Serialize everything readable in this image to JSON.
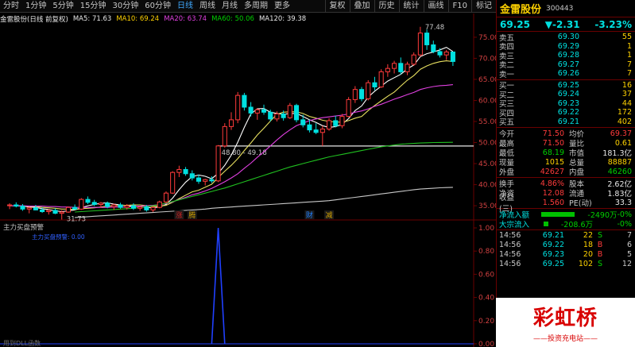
{
  "toolbar": {
    "periods": [
      "分时",
      "1分钟",
      "5分钟",
      "15分钟",
      "30分钟",
      "60分钟",
      "日线",
      "周线",
      "月线",
      "多周期",
      "更多"
    ],
    "active": "日线",
    "actions": [
      "复权",
      "叠加",
      "历史",
      "统计",
      "画线",
      "F10",
      "标记"
    ]
  },
  "infoline": {
    "name": "金雷股份(日线 前复权)",
    "ma5": "MA5: 71.63",
    "ma10": "MA10: 69.24",
    "ma20": "MA20: 63.74",
    "ma60": "MA60: 50.06",
    "ma120": "MA120: 39.38"
  },
  "annotations": {
    "high_label": "77.48",
    "low_label": "31.73",
    "box_label": "48.80 - 49.18",
    "marker1": "涨",
    "marker2": "腾",
    "marker3": "财",
    "marker4": "减",
    "lower_title": "主力买盘预警",
    "lower_sub": "主力买盘预警: 0.00",
    "bottom_label": "用到DLL函数"
  },
  "axis": {
    "ticks": [
      "75.00",
      "70.00",
      "65.00",
      "60.00",
      "55.00",
      "50.00",
      "45.00",
      "40.00",
      "35.00"
    ],
    "lower_ticks": [
      "1.00",
      "0.80",
      "0.60",
      "0.40",
      "0.20",
      "0.00"
    ]
  },
  "quote": {
    "name": "金雷股份",
    "code": "300443",
    "price": "69.25",
    "change": "▼-2.31",
    "pct": "-3.23%"
  },
  "sells": [
    {
      "label": "卖五",
      "price": "69.30",
      "vol": "55"
    },
    {
      "label": "卖四",
      "price": "69.29",
      "vol": "1"
    },
    {
      "label": "卖三",
      "price": "69.28",
      "vol": "1"
    },
    {
      "label": "卖二",
      "price": "69.27",
      "vol": "7"
    },
    {
      "label": "卖一",
      "price": "69.26",
      "vol": "7"
    }
  ],
  "buys": [
    {
      "label": "买一",
      "price": "69.25",
      "vol": "16"
    },
    {
      "label": "买二",
      "price": "69.24",
      "vol": "37"
    },
    {
      "label": "买三",
      "price": "69.23",
      "vol": "44"
    },
    {
      "label": "买四",
      "price": "69.22",
      "vol": "172"
    },
    {
      "label": "买五",
      "price": "69.21",
      "vol": "402"
    }
  ],
  "stats": [
    {
      "l1": "今开",
      "v1": "71.50",
      "c1": "red",
      "l2": "均价",
      "v2": "69.37",
      "c2": "red"
    },
    {
      "l1": "最高",
      "v1": "71.50",
      "c1": "red",
      "l2": "量比",
      "v2": "0.61",
      "c2": "yel"
    },
    {
      "l1": "最低",
      "v1": "68.19",
      "c1": "grn",
      "l2": "市值",
      "v2": "181.3亿",
      "c2": "wht"
    },
    {
      "l1": "现量",
      "v1": "1015",
      "c1": "yel",
      "l2": "总量",
      "v2": "88887",
      "c2": "yel"
    },
    {
      "l1": "外盘",
      "v1": "42627",
      "c1": "red",
      "l2": "内盘",
      "v2": "46260",
      "c2": "grn"
    }
  ],
  "stats2": [
    {
      "l1": "换手",
      "v1": "4.86%",
      "l2": "股本",
      "v2": "2.62亿"
    },
    {
      "l1": "净资",
      "v1": "12.08",
      "l2": "流通",
      "v2": "1.83亿"
    },
    {
      "l1": "收益(三)",
      "v1": "1.560",
      "l2": "PE(动)",
      "v2": "33.3"
    }
  ],
  "flows": [
    {
      "label": "净流入额",
      "value": "-2490万",
      "pct": "-0%"
    },
    {
      "label": "大宗流入",
      "value": "-208.6万",
      "pct": "-0%"
    }
  ],
  "ticks": [
    {
      "time": "14:56",
      "price": "69.21",
      "vol": "22",
      "side": "S",
      "n": "7"
    },
    {
      "time": "14:56",
      "price": "69.22",
      "vol": "18",
      "side": "B",
      "n": "6"
    },
    {
      "time": "14:56",
      "price": "69.23",
      "vol": "20",
      "side": "B",
      "n": "5"
    },
    {
      "time": "14:56",
      "price": "69.25",
      "vol": "102",
      "side": "S",
      "n": "12"
    }
  ],
  "logo": {
    "title": "彩虹桥",
    "sub": "——投资充电站——"
  },
  "colors": {
    "up": "#ff3b3b",
    "down": "#00e0e0",
    "ma5": "#ffffff",
    "ma10": "#e8e060",
    "ma20": "#e040e0",
    "ma60": "#20c020",
    "ma120": "#c8c8c8",
    "border": "#6a0000"
  },
  "chart_data": {
    "type": "candlestick",
    "ylim": [
      32,
      78
    ],
    "candles": [
      [
        35,
        35.6,
        34.2,
        35.2
      ],
      [
        35.2,
        35.8,
        34.6,
        34.9
      ],
      [
        34.9,
        35.4,
        33.8,
        34.2
      ],
      [
        34.2,
        34.8,
        33.2,
        34.5
      ],
      [
        34.5,
        35.2,
        33.9,
        34.0
      ],
      [
        34.0,
        34.6,
        33.3,
        33.6
      ],
      [
        33.6,
        34.2,
        32.9,
        33.9
      ],
      [
        33.9,
        34.4,
        33.0,
        33.2
      ],
      [
        33.2,
        33.9,
        31.73,
        33.5
      ],
      [
        33.5,
        34.8,
        33.3,
        34.6
      ],
      [
        34.6,
        35.3,
        34.0,
        34.2
      ],
      [
        34.2,
        36.8,
        34.0,
        36.5
      ],
      [
        36.5,
        37.2,
        35.4,
        35.8
      ],
      [
        35.8,
        36.4,
        34.9,
        35.3
      ],
      [
        35.3,
        35.9,
        34.5,
        35.6
      ],
      [
        35.6,
        36.0,
        34.4,
        34.8
      ],
      [
        34.8,
        35.5,
        34.0,
        35.2
      ],
      [
        35.2,
        35.7,
        34.3,
        34.6
      ],
      [
        34.6,
        35.4,
        34.1,
        35.0
      ],
      [
        35.0,
        35.6,
        34.0,
        34.4
      ],
      [
        34.4,
        35.0,
        33.8,
        34.7
      ],
      [
        34.7,
        35.2,
        33.6,
        34.0
      ],
      [
        34.0,
        34.9,
        33.5,
        34.6
      ],
      [
        34.6,
        36.2,
        34.4,
        35.9
      ],
      [
        35.9,
        38.4,
        35.6,
        38.0
      ],
      [
        38.0,
        43.2,
        37.8,
        42.9
      ],
      [
        42.9,
        44.5,
        41.8,
        43.6
      ],
      [
        43.6,
        44.2,
        42.1,
        42.6
      ],
      [
        42.6,
        43.4,
        41.0,
        41.6
      ],
      [
        41.6,
        42.4,
        40.2,
        40.8
      ],
      [
        40.8,
        41.4,
        39.8,
        41.2
      ],
      [
        41.2,
        42.0,
        40.4,
        40.9
      ],
      [
        40.9,
        49.4,
        40.6,
        49.2
      ],
      [
        49.2,
        54.6,
        48.8,
        53.8
      ],
      [
        53.8,
        57.2,
        53.0,
        55.4
      ],
      [
        55.4,
        62.0,
        54.6,
        61.2
      ],
      [
        61.2,
        61.8,
        57.6,
        58.4
      ],
      [
        58.4,
        59.6,
        56.2,
        57.0
      ],
      [
        57.0,
        58.2,
        55.4,
        57.8
      ],
      [
        57.8,
        59.0,
        56.6,
        57.2
      ],
      [
        57.2,
        57.8,
        55.0,
        55.6
      ],
      [
        55.6,
        57.4,
        55.0,
        56.8
      ],
      [
        56.8,
        57.6,
        55.2,
        55.9
      ],
      [
        55.9,
        59.4,
        55.6,
        58.8
      ],
      [
        58.8,
        59.2,
        54.8,
        55.4
      ],
      [
        55.4,
        56.6,
        53.6,
        54.2
      ],
      [
        54.2,
        55.4,
        52.4,
        53.0
      ],
      [
        53.0,
        54.6,
        52.0,
        52.4
      ],
      [
        52.4,
        54.0,
        49.18,
        53.2
      ],
      [
        53.2,
        55.8,
        52.8,
        55.2
      ],
      [
        55.2,
        56.4,
        53.6,
        54.0
      ],
      [
        54.0,
        56.8,
        53.4,
        56.2
      ],
      [
        56.2,
        60.8,
        56.0,
        60.2
      ],
      [
        60.2,
        63.4,
        59.4,
        62.6
      ],
      [
        62.6,
        63.2,
        59.8,
        60.4
      ],
      [
        60.4,
        64.8,
        60.0,
        64.2
      ],
      [
        64.2,
        65.6,
        62.4,
        63.2
      ],
      [
        63.2,
        67.4,
        63.0,
        66.8
      ],
      [
        66.8,
        68.6,
        65.6,
        67.6
      ],
      [
        67.6,
        69.4,
        66.4,
        68.8
      ],
      [
        68.8,
        70.2,
        66.2,
        66.8
      ],
      [
        66.8,
        69.2,
        66.0,
        68.6
      ],
      [
        68.6,
        71.4,
        68.2,
        70.8
      ],
      [
        70.8,
        77.48,
        70.4,
        76.0
      ],
      [
        76.0,
        76.8,
        72.0,
        73.2
      ],
      [
        73.2,
        74.2,
        71.2,
        71.6
      ],
      [
        71.6,
        72.4,
        70.2,
        70.8
      ],
      [
        70.8,
        72.0,
        69.6,
        71.5
      ],
      [
        71.5,
        71.5,
        68.19,
        69.25
      ]
    ],
    "ma_series": [
      {
        "name": "MA5",
        "values": [
          35.0,
          35.0,
          34.9,
          34.7,
          34.6,
          34.3,
          34.1,
          33.8,
          33.6,
          33.8,
          34.0,
          34.5,
          35.0,
          35.3,
          35.6,
          35.7,
          35.4,
          35.2,
          35.0,
          34.9,
          34.8,
          34.6,
          34.5,
          34.7,
          35.3,
          36.8,
          38.8,
          40.6,
          41.9,
          42.3,
          42.0,
          41.4,
          42.7,
          44.6,
          47.0,
          50.1,
          53.6,
          56.8,
          58.0,
          58.1,
          57.2,
          56.9,
          56.7,
          56.9,
          56.9,
          56.2,
          55.4,
          54.8,
          54.0,
          53.6,
          53.8,
          54.3,
          55.7,
          57.6,
          58.7,
          60.8,
          62.2,
          63.4,
          64.6,
          65.4,
          66.2,
          67.5,
          68.4,
          70.4,
          71.1,
          71.5,
          72.0,
          72.6,
          71.6
        ]
      },
      {
        "name": "MA10",
        "values": [
          35.0,
          35.0,
          34.9,
          34.8,
          34.8,
          34.6,
          34.5,
          34.4,
          34.2,
          34.2,
          34.1,
          34.3,
          34.4,
          34.5,
          34.7,
          34.9,
          35.0,
          35.1,
          35.1,
          35.2,
          35.2,
          35.0,
          34.8,
          34.9,
          35.1,
          35.8,
          36.7,
          37.5,
          38.3,
          38.7,
          39.4,
          40.1,
          41.7,
          43.2,
          44.6,
          46.2,
          48.1,
          49.9,
          51.8,
          53.4,
          55.1,
          56.7,
          57.2,
          57.3,
          57.3,
          56.9,
          56.2,
          55.8,
          55.3,
          55.0,
          54.9,
          54.8,
          55.2,
          55.8,
          56.2,
          57.6,
          58.8,
          59.9,
          61.0,
          62.0,
          63.4,
          64.8,
          65.9,
          67.4,
          68.2,
          68.8,
          69.2,
          69.4,
          69.24
        ]
      },
      {
        "name": "MA20",
        "values": [
          35.0,
          35.0,
          35.0,
          34.9,
          34.9,
          34.9,
          34.8,
          34.8,
          34.7,
          34.7,
          34.6,
          34.6,
          34.6,
          34.6,
          34.6,
          34.6,
          34.7,
          34.7,
          34.7,
          34.8,
          34.9,
          35.0,
          35.1,
          35.3,
          35.5,
          35.9,
          36.5,
          37.0,
          37.6,
          38.0,
          38.5,
          39.1,
          39.9,
          40.7,
          41.6,
          42.6,
          43.9,
          45.1,
          46.5,
          47.8,
          49.2,
          50.6,
          51.9,
          53.0,
          54.0,
          54.6,
          55.2,
          55.6,
          55.9,
          56.1,
          56.3,
          56.5,
          56.8,
          57.2,
          57.5,
          58.0,
          58.6,
          59.1,
          59.7,
          60.3,
          60.8,
          61.4,
          61.9,
          62.6,
          63.0,
          63.3,
          63.5,
          63.6,
          63.74
        ]
      },
      {
        "name": "MA60",
        "values": [
          null,
          null,
          null,
          null,
          null,
          null,
          null,
          null,
          null,
          null,
          33.5,
          33.6,
          33.7,
          33.8,
          33.9,
          34.0,
          34.1,
          34.2,
          34.3,
          34.4,
          34.6,
          34.8,
          35.0,
          35.3,
          35.6,
          36.0,
          36.4,
          36.8,
          37.2,
          37.6,
          38.0,
          38.4,
          38.8,
          39.2,
          39.7,
          40.2,
          40.7,
          41.2,
          41.7,
          42.2,
          42.7,
          43.2,
          43.7,
          44.2,
          44.6,
          45.0,
          45.4,
          45.8,
          46.2,
          46.6,
          46.9,
          47.2,
          47.5,
          47.8,
          48.1,
          48.4,
          48.7,
          49.0,
          49.2,
          49.4,
          49.6,
          49.7,
          49.8,
          49.9,
          49.95,
          50.0,
          50.02,
          50.04,
          50.06
        ]
      },
      {
        "name": "MA120",
        "values": [
          null,
          null,
          null,
          null,
          null,
          null,
          null,
          null,
          null,
          null,
          32.2,
          32.3,
          32.4,
          32.5,
          32.6,
          32.7,
          32.8,
          32.9,
          33.0,
          33.1,
          33.2,
          33.3,
          33.4,
          33.5,
          33.6,
          33.7,
          33.8,
          33.9,
          34.0,
          34.1,
          34.2,
          34.4,
          34.5,
          34.6,
          34.7,
          34.8,
          34.9,
          35.0,
          35.1,
          35.2,
          35.3,
          35.4,
          35.5,
          35.6,
          35.7,
          35.8,
          35.9,
          36.0,
          36.1,
          36.2,
          36.4,
          36.6,
          36.8,
          37.0,
          37.2,
          37.4,
          37.6,
          37.8,
          38.0,
          38.2,
          38.4,
          38.6,
          38.8,
          38.95,
          39.05,
          39.15,
          39.25,
          39.32,
          39.38
        ]
      }
    ],
    "lower_ylim": [
      0,
      1
    ],
    "signal": {
      "name": "主力买盘预警",
      "values_index": [
        {
          "i": 32,
          "v": 1.0
        },
        {
          "i": 31,
          "v": 0
        },
        {
          "i": 33,
          "v": 0
        }
      ]
    }
  }
}
